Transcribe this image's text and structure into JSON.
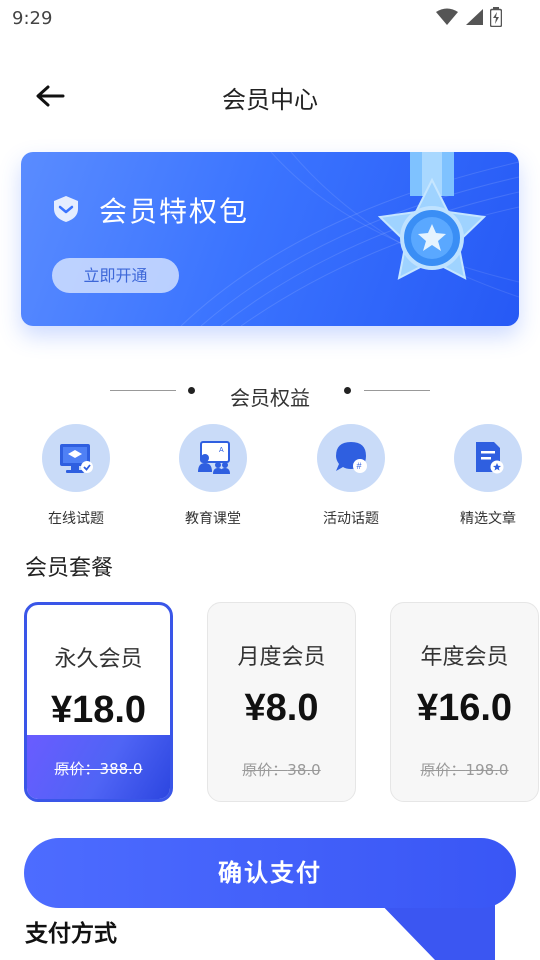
{
  "status": {
    "time": "9:29"
  },
  "header": {
    "title": "会员中心"
  },
  "banner": {
    "title": "会员特权包",
    "button_label": "立即开通"
  },
  "benefits": {
    "title": "会员权益",
    "items": [
      {
        "label": "在线试题",
        "icon": "online-test-icon"
      },
      {
        "label": "教育课堂",
        "icon": "classroom-icon"
      },
      {
        "label": "活动话题",
        "icon": "topic-chat-icon"
      },
      {
        "label": "精选文章",
        "icon": "article-icon"
      }
    ]
  },
  "packages": {
    "title": "会员套餐",
    "items": [
      {
        "name": "永久会员",
        "price": "¥18.0",
        "original_label": "原价：",
        "original_price": "388.0",
        "selected": true
      },
      {
        "name": "月度会员",
        "price": "¥8.0",
        "original_label": "原价：",
        "original_price": "38.0",
        "selected": false
      },
      {
        "name": "年度会员",
        "price": "¥16.0",
        "original_label": "原价：",
        "original_price": "198.0",
        "selected": false
      }
    ]
  },
  "pay": {
    "button_label": "确认支付",
    "method_title": "支付方式"
  },
  "colors": {
    "accent": "#3a56e8",
    "banner": "#3b74ff",
    "benefit_circle": "#c9dbf8"
  }
}
